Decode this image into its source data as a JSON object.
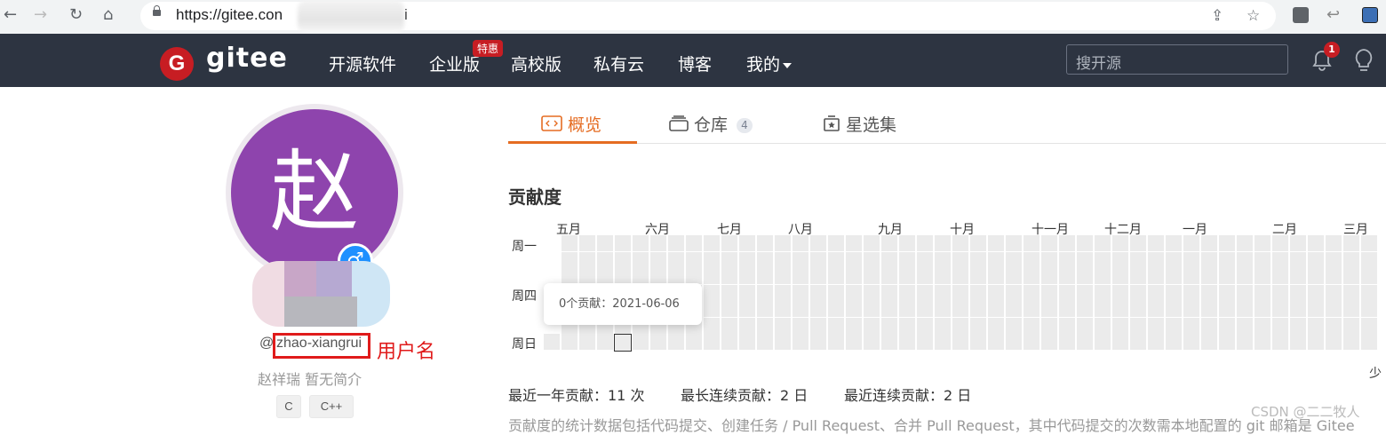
{
  "browser": {
    "url": "https://gitee.con",
    "url_suffix": "i"
  },
  "header": {
    "logo_letter": "G",
    "logo_text": "gitee",
    "nav": [
      "开源软件",
      "企业版",
      "高校版",
      "私有云",
      "博客",
      "我的"
    ],
    "promo_badge": "特惠",
    "search_placeholder": "搜开源",
    "notification_count": "1",
    "colors": {
      "bar": "#2d3441",
      "brand": "#c71d23"
    }
  },
  "profile": {
    "avatar_char": "赵",
    "avatar_color": "#8e44ad",
    "gender_symbol": "♂",
    "at": "@",
    "username": "zhao-xiangrui",
    "annotation": "用户名",
    "bio": "赵祥瑞 暂无简介",
    "tags": [
      "C",
      "C++"
    ]
  },
  "tabs": [
    {
      "label": "概览",
      "active": true
    },
    {
      "label": "仓库",
      "count": "4"
    },
    {
      "label": "星选集"
    }
  ],
  "contrib": {
    "title": "贡献度",
    "months": [
      "五月",
      "六月",
      "七月",
      "八月",
      "九月",
      "十月",
      "十一月",
      "十二月",
      "一月",
      "二月",
      "三月"
    ],
    "weekdays": [
      "周一",
      "周四",
      "周日"
    ],
    "tooltip": "0个贡献：2021-06-06",
    "legend_less": "少",
    "stats": [
      "最近一年贡献：11 次",
      "最长连续贡献：2 日",
      "最近连续贡献：2 日"
    ],
    "description": "贡献度的统计数据包括代码提交、创建任务 / Pull Request、合并 Pull Request，其中代码提交的次数需本地配置的 git 邮箱是 Gitee"
  },
  "watermark": "CSDN @二二牧人"
}
